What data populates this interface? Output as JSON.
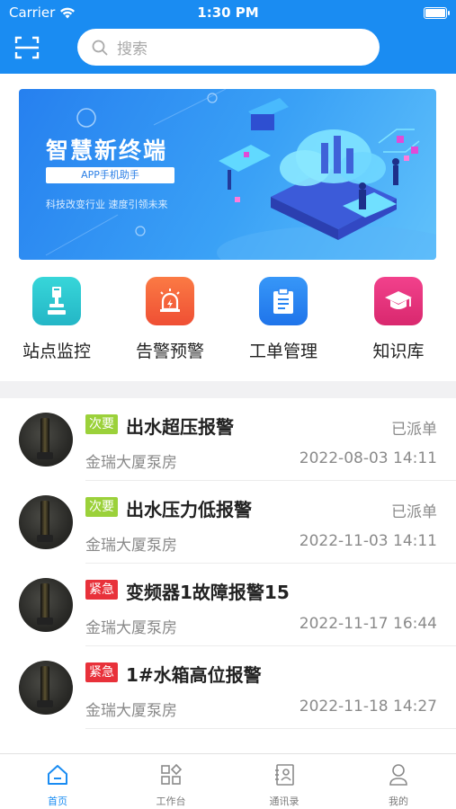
{
  "status_bar": {
    "carrier": "Carrier",
    "time": "1:30 PM"
  },
  "header": {
    "search_placeholder": "搜索"
  },
  "banner": {
    "title": "智慧新终端",
    "subtitle": "APP手机助手",
    "slogan": "科技改变行业 速度引领未来"
  },
  "quick_actions": [
    {
      "label": "站点监控",
      "icon": "site-monitor-icon",
      "color": "#2ec8cf"
    },
    {
      "label": "告警预警",
      "icon": "alarm-icon",
      "color": "#f5623b"
    },
    {
      "label": "工单管理",
      "icon": "work-order-icon",
      "color": "#2a86f3"
    },
    {
      "label": "知识库",
      "icon": "knowledge-icon",
      "color": "#e6327d"
    }
  ],
  "alarms": [
    {
      "level": "次要",
      "level_type": "minor",
      "title": "出水超压报警",
      "status": "已派单",
      "site": "金瑞大厦泵房",
      "time": "2022-08-03 14:11"
    },
    {
      "level": "次要",
      "level_type": "minor",
      "title": "出水压力低报警",
      "status": "已派单",
      "site": "金瑞大厦泵房",
      "time": "2022-11-03 14:11"
    },
    {
      "level": "紧急",
      "level_type": "urgent",
      "title": "变频器1故障报警15",
      "status": "",
      "site": "金瑞大厦泵房",
      "time": "2022-11-17 16:44"
    },
    {
      "level": "紧急",
      "level_type": "urgent",
      "title": "1#水箱高位报警",
      "status": "",
      "site": "金瑞大厦泵房",
      "time": "2022-11-18 14:27"
    }
  ],
  "tabs": [
    {
      "label": "首页",
      "icon": "home-icon",
      "active": true
    },
    {
      "label": "工作台",
      "icon": "workbench-icon",
      "active": false
    },
    {
      "label": "通讯录",
      "icon": "contacts-icon",
      "active": false
    },
    {
      "label": "我的",
      "icon": "profile-icon",
      "active": false
    }
  ],
  "colors": {
    "primary": "#1a8cf2",
    "minor": "#9bd13a",
    "urgent": "#e8313a"
  }
}
